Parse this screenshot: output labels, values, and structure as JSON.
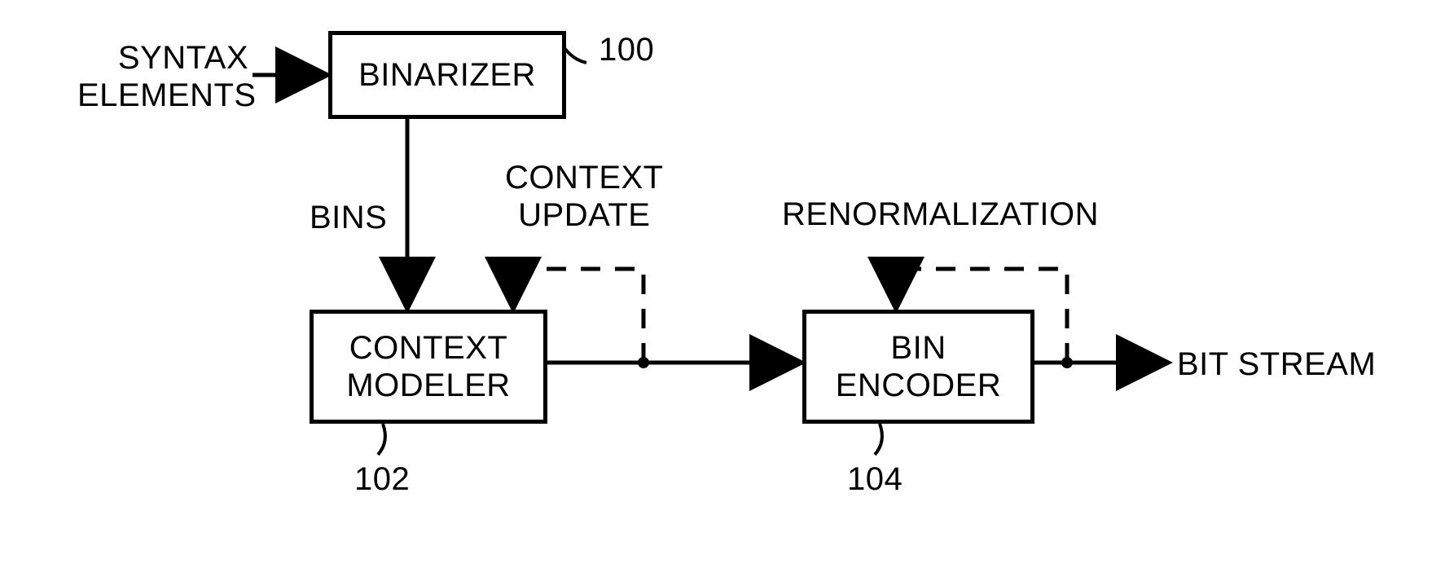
{
  "input_label": "SYNTAX\nELEMENTS",
  "binarizer": {
    "label": "BINARIZER",
    "ref": "100"
  },
  "bins_label": "BINS",
  "context_modeler": {
    "label": "CONTEXT\nMODELER",
    "ref": "102"
  },
  "context_update_label": "CONTEXT\nUPDATE",
  "bin_encoder": {
    "label": "BIN\nENCODER",
    "ref": "104"
  },
  "renorm_label": "RENORMALIZATION",
  "output_label": "BIT STREAM"
}
